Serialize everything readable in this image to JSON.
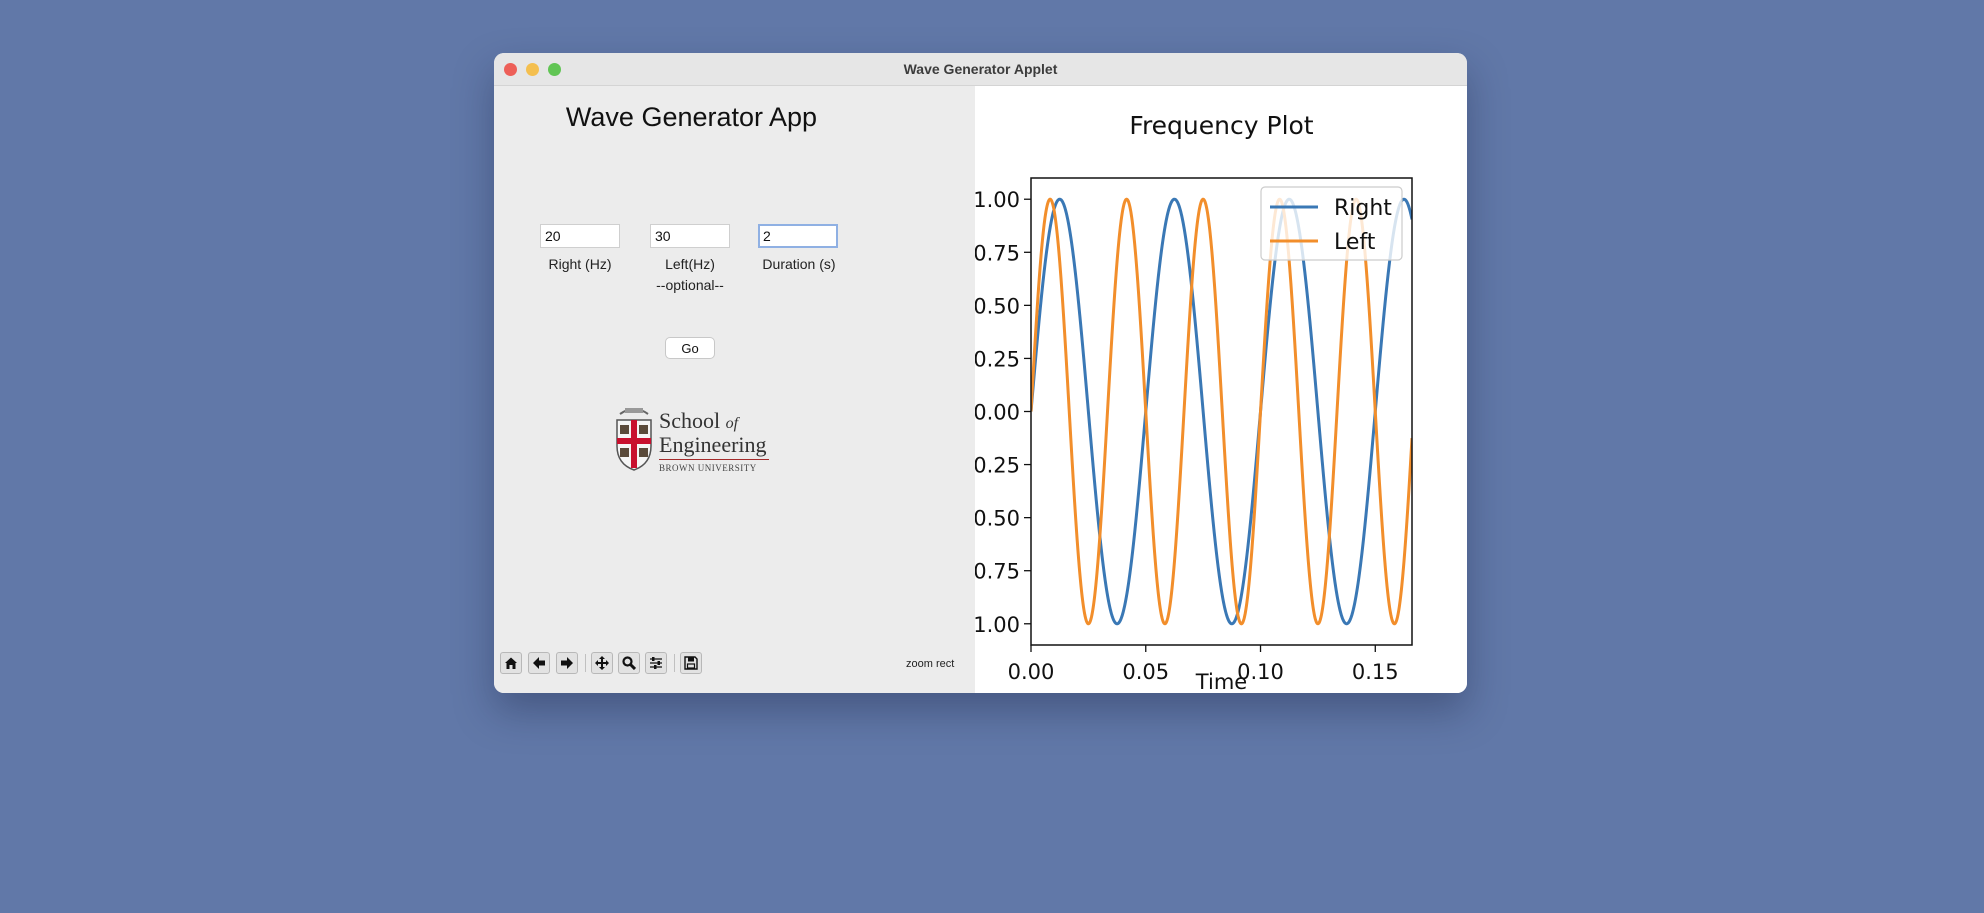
{
  "window": {
    "title": "Wave Generator Applet"
  },
  "app": {
    "title": "Wave Generator App",
    "fields": {
      "right": {
        "value": "20",
        "label": "Right (Hz)"
      },
      "left": {
        "value": "30",
        "label": "Left(Hz)",
        "note": "--optional--"
      },
      "duration": {
        "value": "2",
        "label": "Duration (s)"
      }
    },
    "go_label": "Go",
    "logo": {
      "line1": "School",
      "line1_italic": "of",
      "line2": "Engineering",
      "line3": "BROWN UNIVERSITY"
    }
  },
  "toolbar": {
    "buttons": [
      "home-icon",
      "back-icon",
      "forward-icon",
      "pan-icon",
      "zoom-icon",
      "configure-subplots-icon",
      "save-icon"
    ],
    "status": "zoom rect"
  },
  "chart_data": {
    "type": "line",
    "title": "Frequency Plot",
    "xlabel": "Time",
    "ylabel": "",
    "xlim": [
      0,
      0.166
    ],
    "ylim": [
      -1.1,
      1.1
    ],
    "xticks": [
      0.0,
      0.05,
      0.1,
      0.15
    ],
    "xtick_labels": [
      "0.00",
      "0.05",
      "0.10",
      "0.15"
    ],
    "yticks": [
      1.0,
      0.75,
      0.5,
      0.25,
      0.0,
      -0.25,
      -0.5,
      -0.75,
      -1.0
    ],
    "ytick_labels": [
      "1.00",
      "0.75",
      "0.50",
      "0.25",
      "0.00",
      "0.25",
      "0.50",
      "0.75",
      "1.00"
    ],
    "legend_position": "top-right",
    "series": [
      {
        "name": "Right",
        "function": "sin",
        "frequency_hz": 20,
        "amplitude": 1,
        "color": "#3a78b5"
      },
      {
        "name": "Left",
        "function": "sin",
        "frequency_hz": 30,
        "amplitude": 1,
        "color": "#f28e2b"
      }
    ]
  }
}
